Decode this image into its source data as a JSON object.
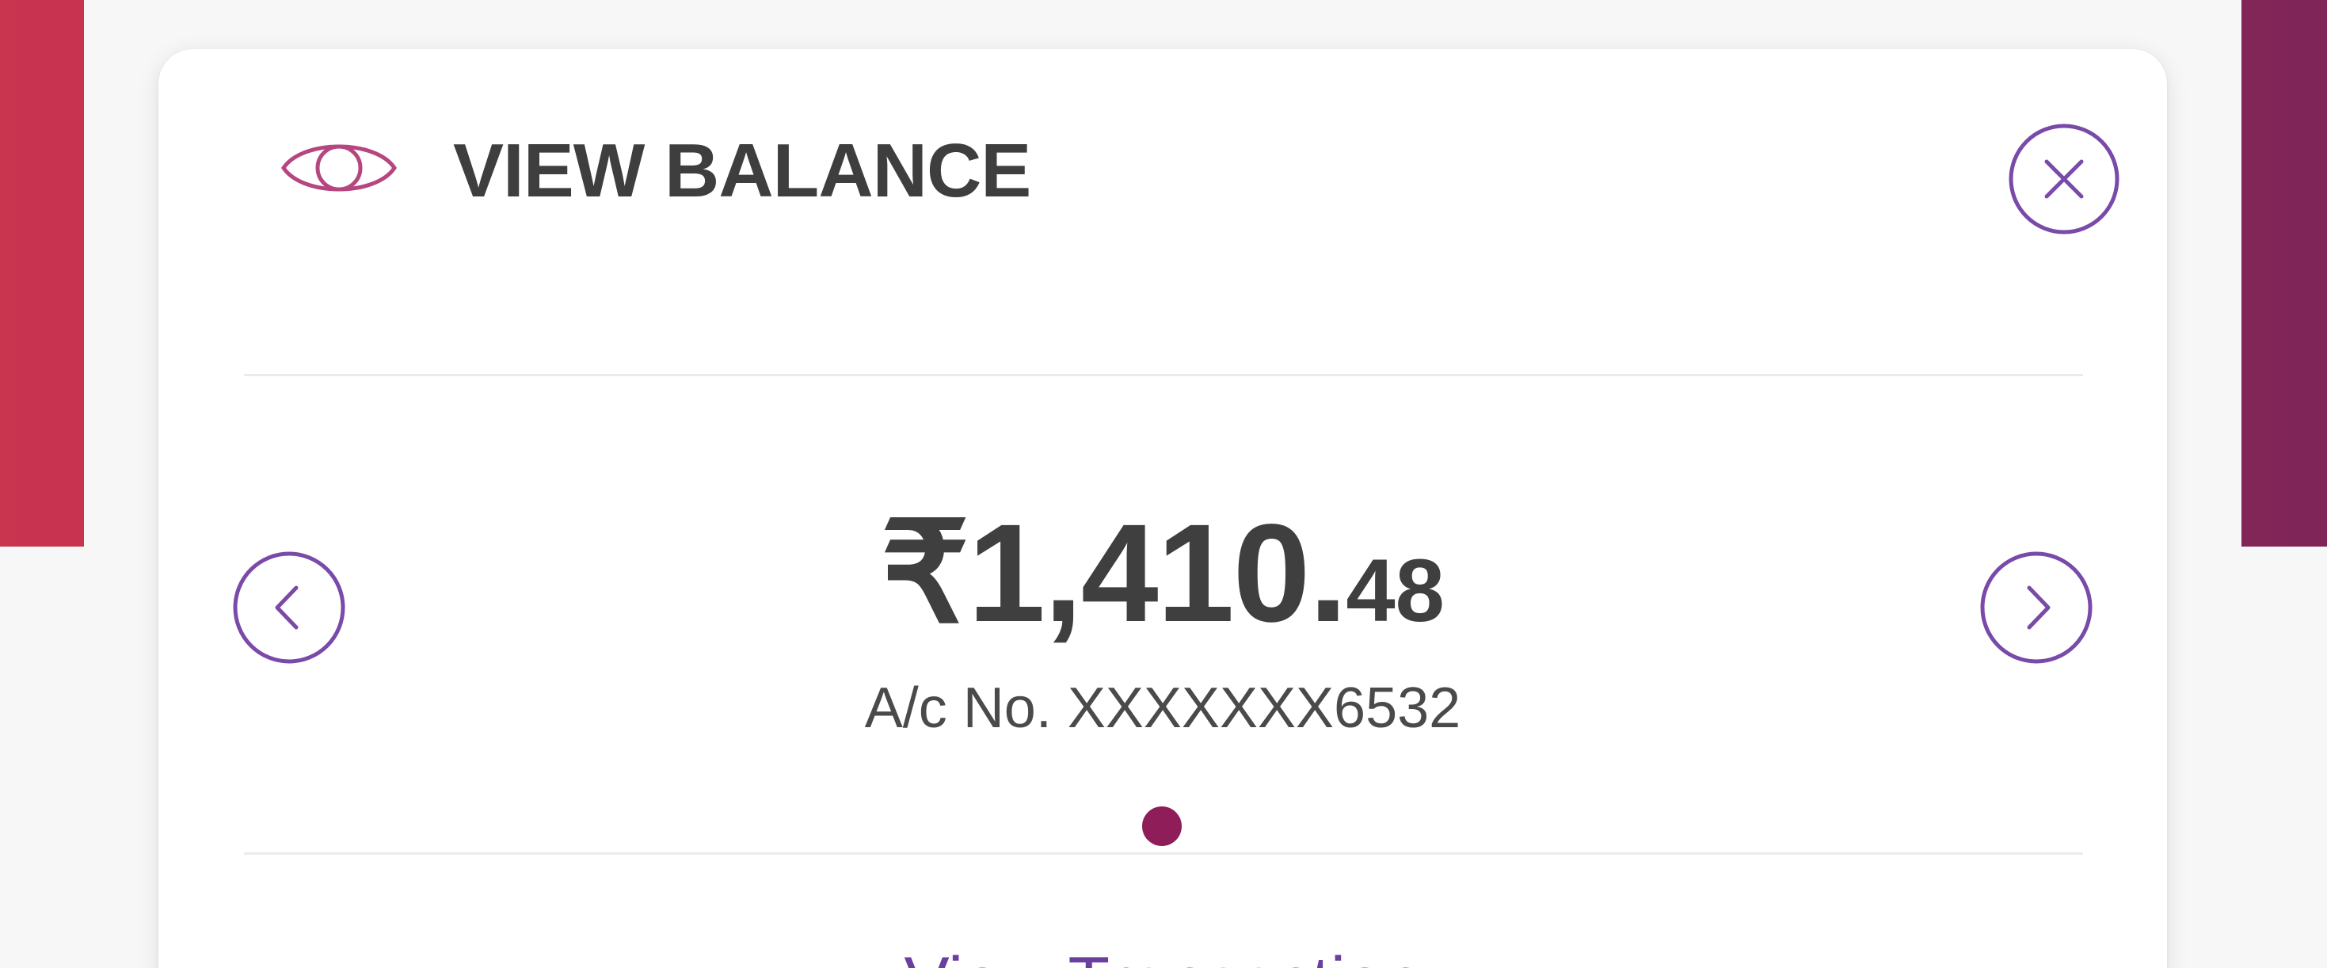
{
  "header": {
    "title": "VIEW BALANCE",
    "icon": "eye-icon",
    "close_icon": "close-icon"
  },
  "balance": {
    "currency": "₹",
    "amount_main": "1,410.",
    "amount_decimal": "48",
    "account_label": "A/c No. XXXXXXX6532"
  },
  "carousel": {
    "prev_icon": "chevron-left-icon",
    "next_icon": "chevron-right-icon",
    "page_count": 1,
    "active_index": 0
  },
  "footer": {
    "link_text": "View Transaction"
  },
  "colors": {
    "accent": "#7a4aa8",
    "eye": "#b5467f",
    "dot": "#8e1d59",
    "band_left": "#c9344f",
    "band_right": "#7f2558"
  }
}
